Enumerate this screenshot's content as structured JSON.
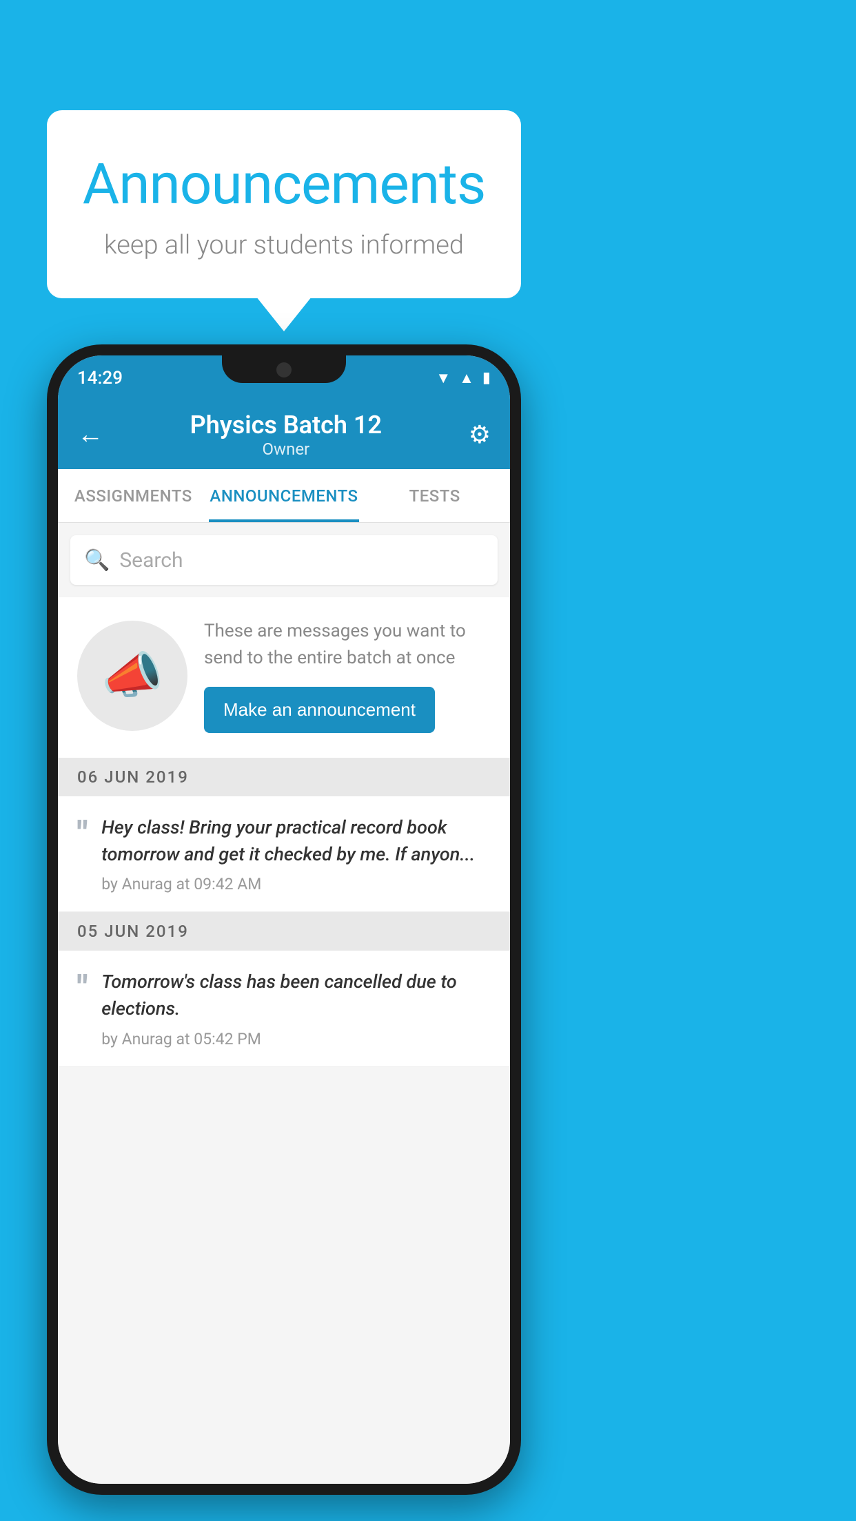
{
  "background_color": "#1ab3e8",
  "bubble": {
    "title": "Announcements",
    "subtitle": "keep all your students informed"
  },
  "phone": {
    "status_bar": {
      "time": "14:29"
    },
    "header": {
      "title": "Physics Batch 12",
      "subtitle": "Owner",
      "back_label": "←",
      "gear_label": "⚙"
    },
    "tabs": [
      {
        "label": "ASSIGNMENTS",
        "active": false
      },
      {
        "label": "ANNOUNCEMENTS",
        "active": true
      },
      {
        "label": "TESTS",
        "active": false
      }
    ],
    "search": {
      "placeholder": "Search"
    },
    "prompt": {
      "description": "These are messages you want to send to the entire batch at once",
      "button_label": "Make an announcement"
    },
    "announcements": [
      {
        "date": "06  JUN  2019",
        "text": "Hey class! Bring your practical record book tomorrow and get it checked by me. If anyon...",
        "meta": "by Anurag at 09:42 AM"
      },
      {
        "date": "05  JUN  2019",
        "text": "Tomorrow's class has been cancelled due to elections.",
        "meta": "by Anurag at 05:42 PM"
      }
    ]
  }
}
